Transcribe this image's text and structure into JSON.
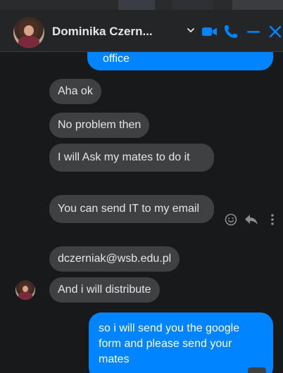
{
  "header": {
    "contact_name": "Dominika Czern...",
    "chevron_icon": "chevron-down-icon",
    "video_icon": "video-camera-icon",
    "call_icon": "phone-icon",
    "minimize_icon": "minimize-icon",
    "close_icon": "close-icon",
    "accent_color": "#0084ff"
  },
  "messages": [
    {
      "direction": "outgoing",
      "text": "office"
    },
    {
      "direction": "incoming",
      "text": "Aha ok"
    },
    {
      "direction": "incoming",
      "text": "No problem then"
    },
    {
      "direction": "incoming",
      "text": "I will Ask my mates to do it"
    },
    {
      "direction": "incoming",
      "text": "You can send IT to my email"
    },
    {
      "direction": "incoming",
      "text": "dczerniak@wsb.edu.pl"
    },
    {
      "direction": "incoming",
      "text": "And i will distribute"
    },
    {
      "direction": "outgoing",
      "text": "so i will send you the google  form and please send your mates"
    }
  ],
  "message_actions": {
    "react_icon": "smiley-icon",
    "reply_icon": "reply-icon",
    "more_icon": "more-options-icon"
  },
  "colors": {
    "incoming_bubble": "#3e4042",
    "outgoing_bubble": "#0084ff",
    "background": "#18191a"
  }
}
